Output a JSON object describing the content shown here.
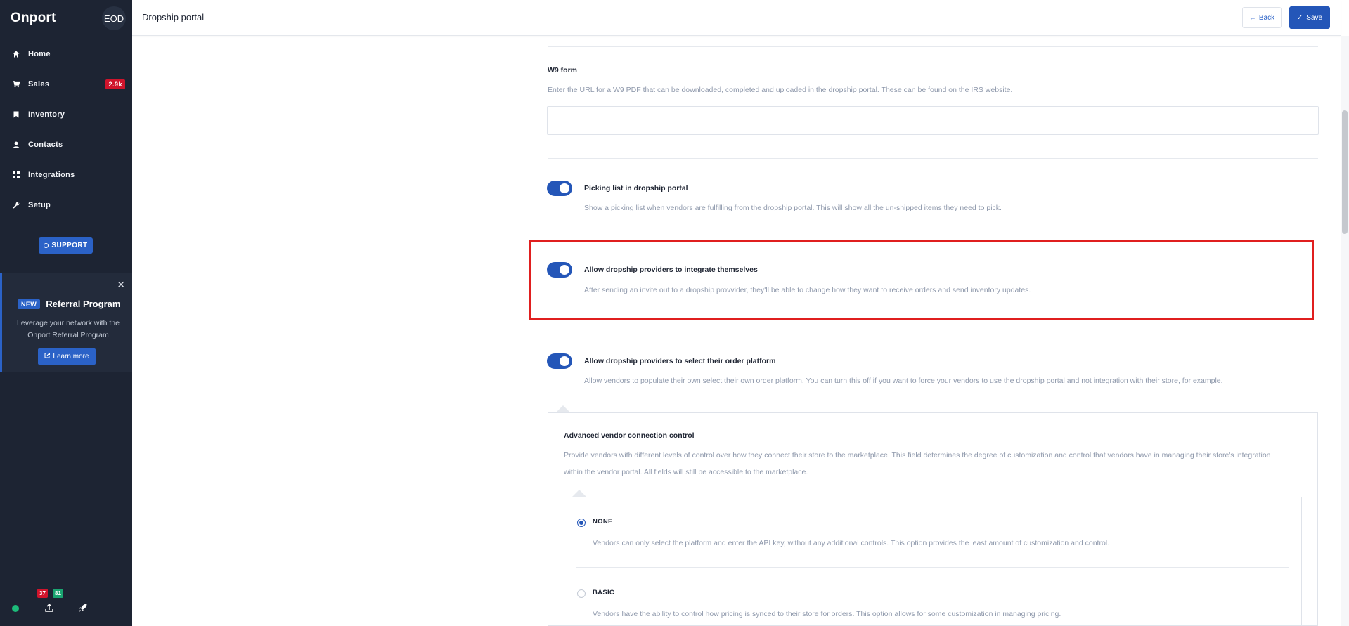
{
  "app": {
    "brand": "Onport",
    "org_initials": "EOD"
  },
  "sidebar": {
    "items": [
      {
        "label": "Home",
        "icon": "home-icon"
      },
      {
        "label": "Sales",
        "icon": "cart-icon",
        "badge": "2.9k"
      },
      {
        "label": "Inventory",
        "icon": "bookmark-icon"
      },
      {
        "label": "Contacts",
        "icon": "person-icon"
      },
      {
        "label": "Integrations",
        "icon": "grid-icon"
      },
      {
        "label": "Setup",
        "icon": "wrench-icon"
      }
    ],
    "support_label": "SUPPORT",
    "referral": {
      "badge": "NEW",
      "title": "Referral Program",
      "text": "Leverage your network with the Onport Referral Program",
      "button": "Learn more"
    },
    "footer": {
      "red_count": "37",
      "green_count": "81"
    }
  },
  "header": {
    "title": "Dropship portal",
    "back_label": "Back",
    "save_label": "Save"
  },
  "form": {
    "w9": {
      "title": "W9 form",
      "description": "Enter the URL for a W9 PDF that can be downloaded, completed and uploaded in the dropship portal. These can be found on the IRS website.",
      "value": ""
    },
    "picking": {
      "title": "Picking list in dropship portal",
      "description": "Show a picking list when vendors are fulfilling from the dropship portal. This will show all the un-shipped items they need to pick.",
      "enabled": true
    },
    "integrate": {
      "title": "Allow dropship providers to integrate themselves",
      "description": "After sending an invite out to a dropship provvider, they'll be able to change how they want to receive orders and send inventory updates.",
      "enabled": true
    },
    "platform": {
      "title": "Allow dropship providers to select their order platform",
      "description": "Allow vendors to populate their own select their own order platform. You can turn this off if you want to force your vendors to use the dropship portal and not integration with their store, for example.",
      "enabled": true
    },
    "advanced": {
      "title": "Advanced vendor connection control",
      "description_line1": "Provide vendors with different levels of control over how they connect their store to the marketplace. This field determines the degree of customization and control that vendors have in managing their store's integration",
      "description_line2": "within the vendor portal. All fields will still be accessible to the marketplace.",
      "options": [
        {
          "label": "NONE",
          "description": "Vendors can only select the platform and enter the API key, without any additional controls. This option provides the least amount of customization and control.",
          "selected": true
        },
        {
          "label": "BASIC",
          "description": "Vendors have the ability to control how pricing is synced to their store for orders. This option allows for some customization in managing pricing.",
          "selected": false
        }
      ]
    }
  },
  "colors": {
    "sidebar_bg": "#1d2433",
    "accent": "#2456b8",
    "badge_red": "#d0142c",
    "badge_green": "#1aa571",
    "highlight": "#e01f1f"
  }
}
